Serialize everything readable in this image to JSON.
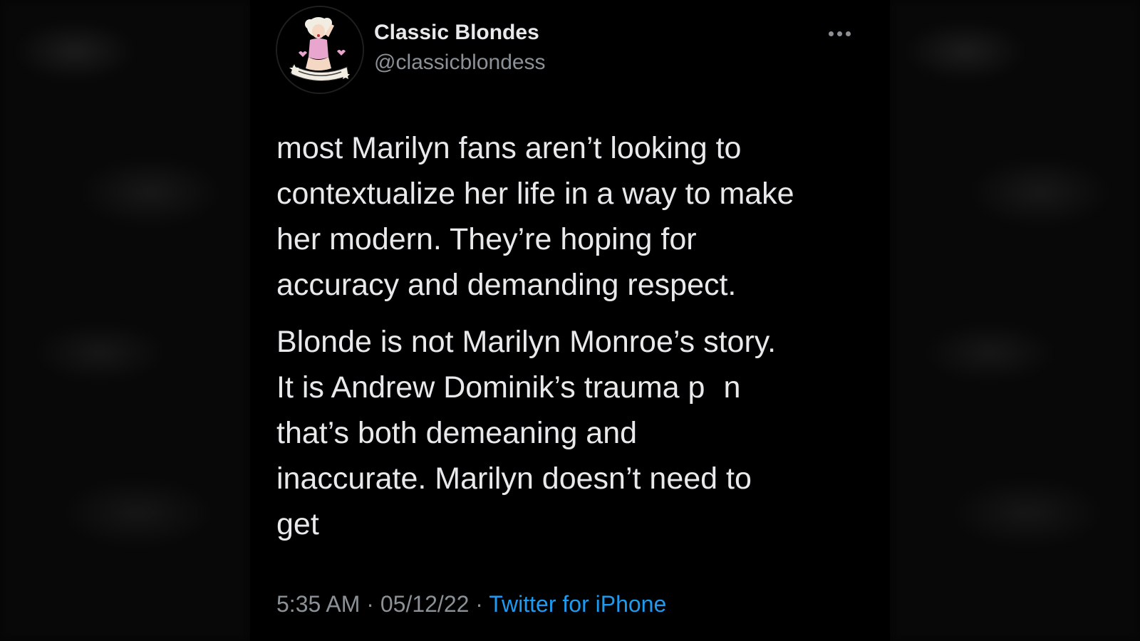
{
  "tweet": {
    "display_name": "Classic Blondes",
    "handle": "@classicblondess",
    "paragraph1": [
      "most Marilyn fans aren’t looking to",
      "contextualize her life in a way to make",
      "her modern. They’re hoping for",
      "accuracy and demanding respect."
    ],
    "paragraph2": [
      "Blonde is not Marilyn Monroe’s story.",
      "It is Andrew Dominik’s trauma p",
      "n",
      "that’s both demeaning and",
      "inaccurate. Marilyn doesn’t need to",
      "get"
    ],
    "time": "5:35 AM",
    "separator": "·",
    "date": "05/12/22",
    "source": "Twitter for iPhone"
  },
  "icons": {
    "avatar": "pinup-girl-avatar",
    "more": "more-horizontal-icon"
  },
  "colors": {
    "background": "#000000",
    "text": "#e7e9ea",
    "secondary": "#8b9196",
    "link": "#1d9bf0"
  }
}
